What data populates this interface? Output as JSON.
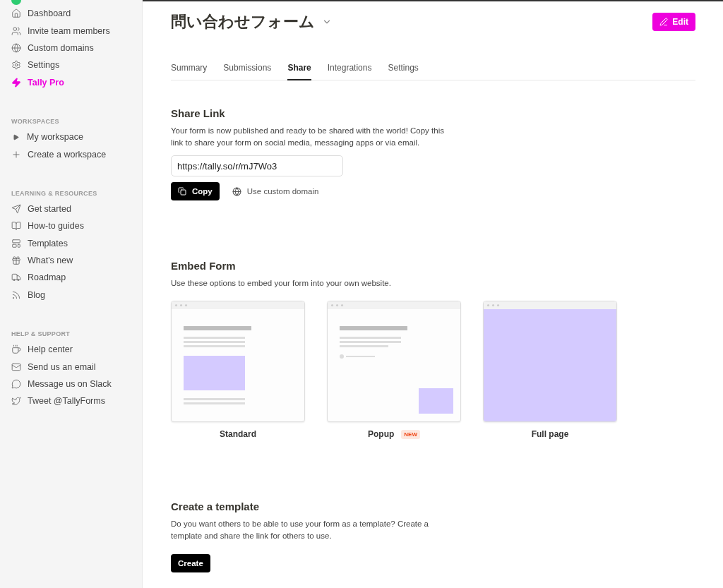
{
  "sidebar": {
    "nav": [
      {
        "label": "Dashboard",
        "kind": "normal"
      },
      {
        "label": "Invite team members",
        "kind": "normal"
      },
      {
        "label": "Custom domains",
        "kind": "normal"
      },
      {
        "label": "Settings",
        "kind": "normal"
      },
      {
        "label": "Tally Pro",
        "kind": "pro"
      }
    ],
    "sections": [
      {
        "title": "WORKSPACES",
        "items": [
          {
            "label": "My workspace",
            "kind": "tree",
            "expanded": false
          },
          {
            "label": "Create a workspace",
            "kind": "add"
          }
        ]
      },
      {
        "title": "LEARNING & RESOURCES",
        "items": [
          {
            "label": "Get started",
            "kind": "link"
          },
          {
            "label": "How-to guides",
            "kind": "link"
          },
          {
            "label": "Templates",
            "kind": "link"
          },
          {
            "label": "What's new",
            "kind": "link"
          },
          {
            "label": "Roadmap",
            "kind": "link"
          },
          {
            "label": "Blog",
            "kind": "link"
          }
        ]
      },
      {
        "title": "HELP & SUPPORT",
        "items": [
          {
            "label": "Help center",
            "kind": "link"
          },
          {
            "label": "Send us an email",
            "kind": "link"
          },
          {
            "label": "Message us on Slack",
            "kind": "link"
          },
          {
            "label": "Tweet @TallyForms",
            "kind": "link"
          }
        ]
      }
    ]
  },
  "header": {
    "title": "問い合わせフォーム",
    "edit_button": "Edit"
  },
  "tabs": [
    {
      "label": "Summary",
      "selected": false
    },
    {
      "label": "Submissions",
      "selected": false
    },
    {
      "label": "Share",
      "selected": true
    },
    {
      "label": "Integrations",
      "selected": false
    },
    {
      "label": "Settings",
      "selected": false
    }
  ],
  "share_link": {
    "heading": "Share Link",
    "description": "Your form is now published and ready to be shared with the world! Copy this link to share your form on social media, messaging apps or via email.",
    "url": "https://tally.so/r/mJ7Wo3",
    "copy_button": "Copy",
    "custom_domain_link": "Use custom domain"
  },
  "embed": {
    "heading": "Embed Form",
    "description": "Use these options to embed your form into your own website.",
    "options": [
      {
        "kind": "standard",
        "label": "Standard"
      },
      {
        "kind": "popup",
        "label": "Popup",
        "badge": "NEW"
      },
      {
        "kind": "fullpage",
        "label": "Full page"
      }
    ]
  },
  "template": {
    "heading": "Create a template",
    "description": "Do you want others to be able to use your form as a template? Create a template and share the link for others to use.",
    "button": "Create"
  }
}
